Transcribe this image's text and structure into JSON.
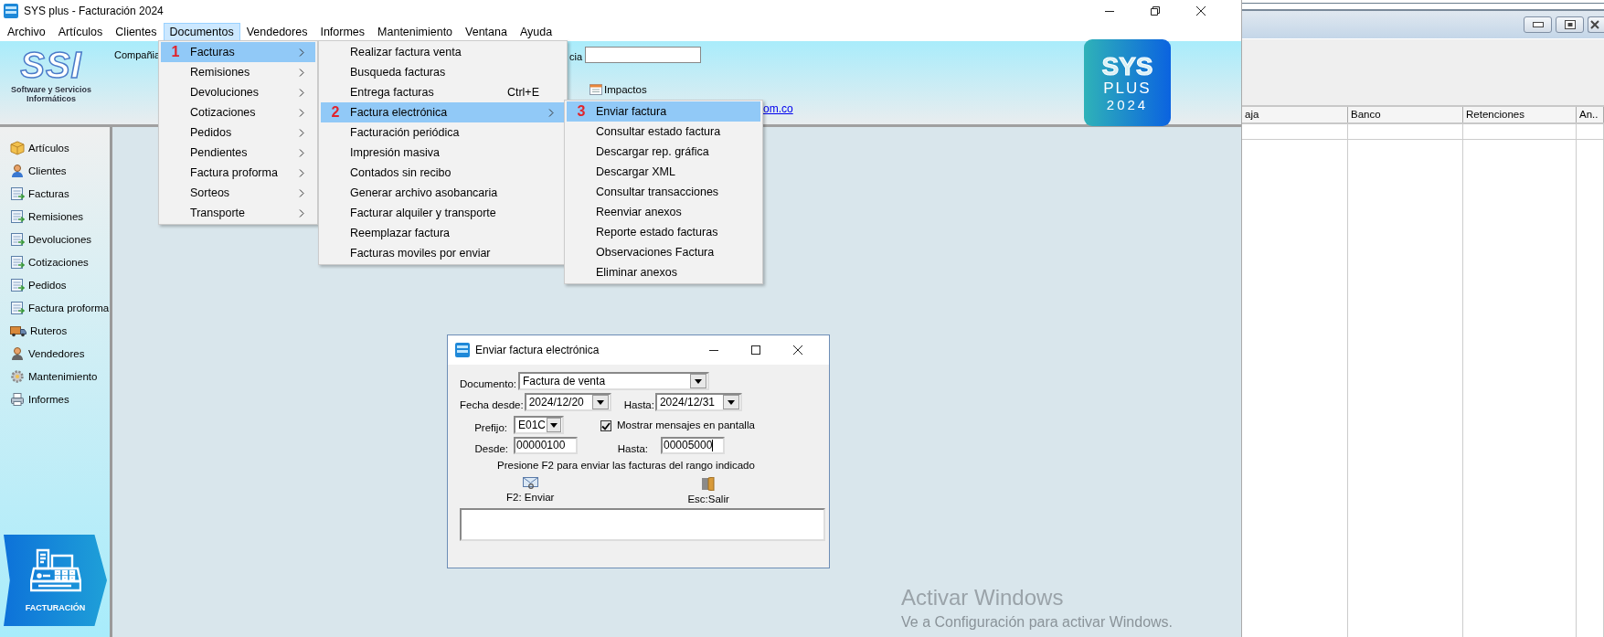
{
  "window": {
    "title": "SYS plus - Facturación 2024"
  },
  "menu_bar": [
    {
      "label": "Archivo",
      "selected": false
    },
    {
      "label": "Artículos",
      "selected": false
    },
    {
      "label": "Clientes",
      "selected": false
    },
    {
      "label": "Documentos",
      "selected": true
    },
    {
      "label": "Vendedores",
      "selected": false
    },
    {
      "label": "Informes",
      "selected": false
    },
    {
      "label": "Mantenimiento",
      "selected": false
    },
    {
      "label": "Ventana",
      "selected": false
    },
    {
      "label": "Ayuda",
      "selected": false
    }
  ],
  "header": {
    "logo_letters": "SSI",
    "logo_caption": "Software y Servicios Informáticos",
    "company_label": "Compañia",
    "field_label": "cia",
    "impactos": "Impactos",
    "link": "om.co",
    "brand": {
      "name": "SYS",
      "line": "PLUS",
      "year": "2024"
    }
  },
  "menus": [
    {
      "items": [
        {
          "label": "Facturas",
          "submenu": true,
          "selected": true,
          "step": "1"
        },
        {
          "label": "Remisiones",
          "submenu": true,
          "selected": false
        },
        {
          "label": "Devoluciones",
          "submenu": true,
          "selected": false
        },
        {
          "label": "Cotizaciones",
          "submenu": true,
          "selected": false
        },
        {
          "label": "Pedidos",
          "submenu": true,
          "selected": false
        },
        {
          "label": "Pendientes",
          "submenu": true,
          "selected": false
        },
        {
          "label": "Factura proforma",
          "submenu": true,
          "selected": false
        },
        {
          "label": "Sorteos",
          "submenu": true,
          "selected": false
        },
        {
          "label": "Transporte",
          "submenu": true,
          "selected": false
        }
      ]
    },
    {
      "items": [
        {
          "label": "Realizar factura venta",
          "submenu": false,
          "selected": false
        },
        {
          "label": "Busqueda facturas",
          "submenu": false,
          "selected": false
        },
        {
          "label": "Entrega facturas",
          "submenu": false,
          "selected": false,
          "shortcut": "Ctrl+E"
        },
        {
          "label": "Factura electrónica",
          "submenu": true,
          "selected": true,
          "step": "2"
        },
        {
          "label": "Facturación periódica",
          "submenu": false,
          "selected": false
        },
        {
          "label": "Impresión masiva",
          "submenu": false,
          "selected": false
        },
        {
          "label": "Contados sin recibo",
          "submenu": false,
          "selected": false
        },
        {
          "label": "Generar archivo asobancaria",
          "submenu": false,
          "selected": false
        },
        {
          "label": "Facturar alquiler y transporte",
          "submenu": false,
          "selected": false
        },
        {
          "label": "Reemplazar factura",
          "submenu": false,
          "selected": false
        },
        {
          "label": "Facturas moviles por enviar",
          "submenu": false,
          "selected": false
        }
      ]
    },
    {
      "items": [
        {
          "label": "Enviar factura",
          "submenu": false,
          "selected": true,
          "step": "3"
        },
        {
          "label": "Consultar estado factura",
          "submenu": false,
          "selected": false
        },
        {
          "label": "Descargar rep. gráfica",
          "submenu": false,
          "selected": false
        },
        {
          "label": "Descargar XML",
          "submenu": false,
          "selected": false
        },
        {
          "label": "Consultar transacciones",
          "submenu": false,
          "selected": false
        },
        {
          "label": "Reenviar anexos",
          "submenu": false,
          "selected": false
        },
        {
          "label": "Reporte estado facturas",
          "submenu": false,
          "selected": false
        },
        {
          "label": "Observaciones Factura",
          "submenu": false,
          "selected": false
        },
        {
          "label": "Eliminar anexos",
          "submenu": false,
          "selected": false
        }
      ]
    }
  ],
  "sidebar": {
    "items": [
      "Artículos",
      "Clientes",
      "Facturas",
      "Remisiones",
      "Devoluciones",
      "Cotizaciones",
      "Pedidos",
      "Factura proforma",
      "Ruteros",
      "Vendedores",
      "Mantenimiento",
      "Informes"
    ],
    "badge": "FACTURACIÓN"
  },
  "dialog": {
    "title": "Enviar factura electrónica",
    "document": {
      "label": "Documento:",
      "value": "Factura de venta"
    },
    "date_from": {
      "label": "Fecha desde:",
      "value": "2024/12/20"
    },
    "date_to": {
      "label": "Hasta:",
      "value": "2024/12/31"
    },
    "prefix": {
      "label": "Prefijo:",
      "value": "E01C"
    },
    "show_messages": {
      "label": "Mostrar mensajes en pantalla",
      "checked": true
    },
    "number_from": {
      "label": "Desde:",
      "value": "00000100",
      "focused": false
    },
    "number_to": {
      "label": "Hasta:",
      "value": "00005000",
      "focused": true
    },
    "hint": "Presione F2 para enviar las facturas del rango indicado",
    "actions": [
      {
        "label": "F2: Enviar",
        "kind": "send"
      },
      {
        "label": "Esc:Salir",
        "kind": "exit"
      }
    ]
  },
  "background_window": {
    "columns": [
      "aja",
      "Banco",
      "Retenciones",
      "An.."
    ]
  },
  "activation": {
    "title": "Activar Windows",
    "text": "Ve a Configuración para activar Windows."
  }
}
